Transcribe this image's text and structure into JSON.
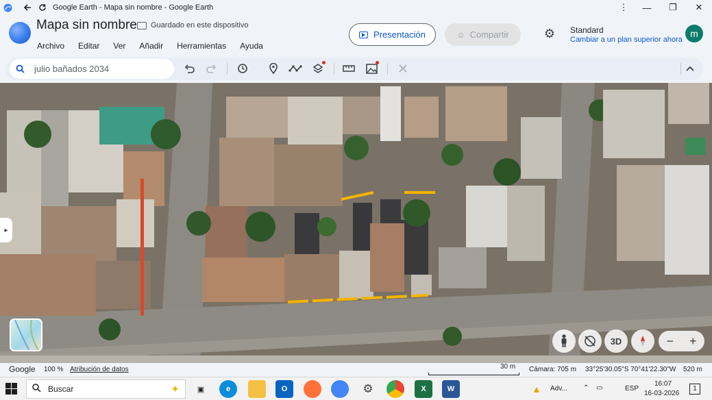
{
  "window": {
    "title": "Google Earth - Mapa sin nombre - Google Earth",
    "minimize": "⋮",
    "controls": [
      "—",
      "❐",
      "✕"
    ]
  },
  "header": {
    "doc_title": "Mapa sin nombre",
    "saved_status": "Guardado en este dispositivo",
    "menu": [
      "Archivo",
      "Editar",
      "Ver",
      "Añadir",
      "Herramientas",
      "Ayuda"
    ],
    "present_label": "Presentación",
    "share_label": "Compartir",
    "plan_name": "Standard",
    "plan_link": "Cambiar a un plan superior ahora",
    "avatar_letter": "m"
  },
  "toolbar": {
    "search_value": "julio bañados 2034",
    "tools": [
      "undo-icon",
      "redo-icon",
      "history-icon",
      "placemark-icon",
      "path-icon",
      "layers-icon",
      "ruler-icon",
      "image-overlay-icon",
      "tools-icon"
    ]
  },
  "map": {
    "controls": {
      "street_view": "pegman-icon",
      "tilt": "tilt-icon",
      "mode_3d": "3D",
      "compass": "compass-icon",
      "zoom_out": "−",
      "zoom_in": "+"
    }
  },
  "statusbar": {
    "google": "Google",
    "zoom_pct": "100 %",
    "attribution": "Atribución de datos",
    "scale": "30 m",
    "camera": "Cámara: 705 m",
    "coords": "33°25'30.05\"S 70°41'22.30\"W",
    "elevation": "520 m"
  },
  "taskbar": {
    "search_placeholder": "Buscar",
    "weather": "Adv...",
    "lang": "ESP",
    "time": "16:07",
    "date": "16-03-2026",
    "notif_count": "1"
  },
  "colors": {
    "accent": "#0b57d0",
    "avatar_bg": "#0b7b6b",
    "path_yellow": "#f4b400"
  }
}
